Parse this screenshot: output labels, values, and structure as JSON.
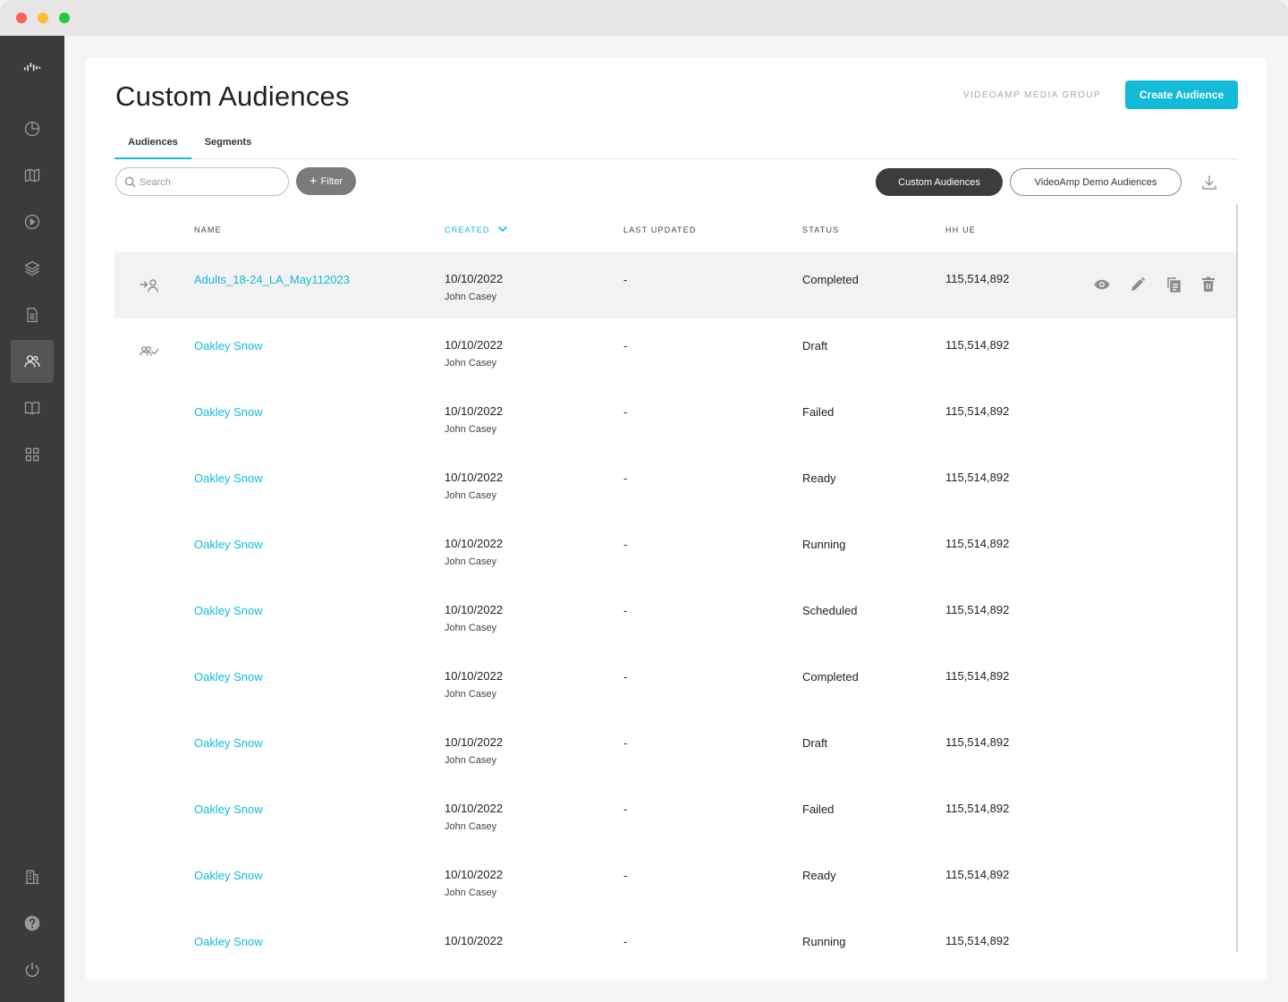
{
  "window": {
    "controls": [
      "close",
      "minimize",
      "maximize"
    ]
  },
  "sidebar": {
    "items": [
      {
        "icon": "waveform-logo-icon"
      },
      {
        "icon": "pie-chart-icon"
      },
      {
        "icon": "map-icon"
      },
      {
        "icon": "play-circle-icon"
      },
      {
        "icon": "layers-icon"
      },
      {
        "icon": "document-icon"
      },
      {
        "icon": "users-icon",
        "active": true
      },
      {
        "icon": "book-icon"
      },
      {
        "icon": "grid-icon"
      },
      {
        "icon": "building-icon"
      },
      {
        "icon": "help-icon"
      },
      {
        "icon": "power-icon"
      }
    ]
  },
  "header": {
    "title": "Custom Audiences",
    "org": "VIDEOAMP MEDIA GROUP",
    "create_label": "Create Audience"
  },
  "tabs": [
    {
      "label": "Audiences",
      "active": true
    },
    {
      "label": "Segments",
      "active": false
    }
  ],
  "toolbar": {
    "search_placeholder": "Search",
    "filter_label": "Filter",
    "view_custom": "Custom Audiences",
    "view_demo": "VideoAmp Demo Audiences"
  },
  "table": {
    "columns": {
      "name": "NAME",
      "created": "CREATED",
      "last_updated": "LAST UPDATED",
      "status": "STATUS",
      "hh_ue": "HH UE"
    },
    "sort": {
      "column": "created",
      "direction": "desc"
    },
    "rows": [
      {
        "name": "Adults_18-24_LA_May112023",
        "created": "10/10/2022",
        "created_by": "John Casey",
        "last_updated": "-",
        "status": "Completed",
        "hh_ue": "115,514,892",
        "type_icon": "user-add-icon",
        "hovered": true
      },
      {
        "name": "Oakley Snow",
        "created": "10/10/2022",
        "created_by": "John Casey",
        "last_updated": "-",
        "status": "Draft",
        "hh_ue": "115,514,892",
        "type_icon": "users-check-icon"
      },
      {
        "name": "Oakley Snow",
        "created": "10/10/2022",
        "created_by": "John Casey",
        "last_updated": "-",
        "status": "Failed",
        "hh_ue": "115,514,892"
      },
      {
        "name": "Oakley Snow",
        "created": "10/10/2022",
        "created_by": "John Casey",
        "last_updated": "-",
        "status": "Ready",
        "hh_ue": "115,514,892"
      },
      {
        "name": "Oakley Snow",
        "created": "10/10/2022",
        "created_by": "John Casey",
        "last_updated": "-",
        "status": "Running",
        "hh_ue": "115,514,892"
      },
      {
        "name": "Oakley Snow",
        "created": "10/10/2022",
        "created_by": "John Casey",
        "last_updated": "-",
        "status": "Scheduled",
        "hh_ue": "115,514,892"
      },
      {
        "name": "Oakley Snow",
        "created": "10/10/2022",
        "created_by": "John Casey",
        "last_updated": "-",
        "status": "Completed",
        "hh_ue": "115,514,892"
      },
      {
        "name": "Oakley Snow",
        "created": "10/10/2022",
        "created_by": "John Casey",
        "last_updated": "-",
        "status": "Draft",
        "hh_ue": "115,514,892"
      },
      {
        "name": "Oakley Snow",
        "created": "10/10/2022",
        "created_by": "John Casey",
        "last_updated": "-",
        "status": "Failed",
        "hh_ue": "115,514,892"
      },
      {
        "name": "Oakley Snow",
        "created": "10/10/2022",
        "created_by": "John Casey",
        "last_updated": "-",
        "status": "Ready",
        "hh_ue": "115,514,892"
      },
      {
        "name": "Oakley Snow",
        "created": "10/10/2022",
        "created_by": "",
        "last_updated": "-",
        "status": "Running",
        "hh_ue": "115,514,892"
      }
    ],
    "row_actions": [
      "eye-icon",
      "pencil-icon",
      "copy-icon",
      "trash-icon"
    ]
  },
  "colors": {
    "accent": "#14bbd8",
    "sidebar_bg": "#3b3b3b",
    "dark_pill": "#3c3c3c",
    "filter_bg": "#7b7b7b"
  }
}
